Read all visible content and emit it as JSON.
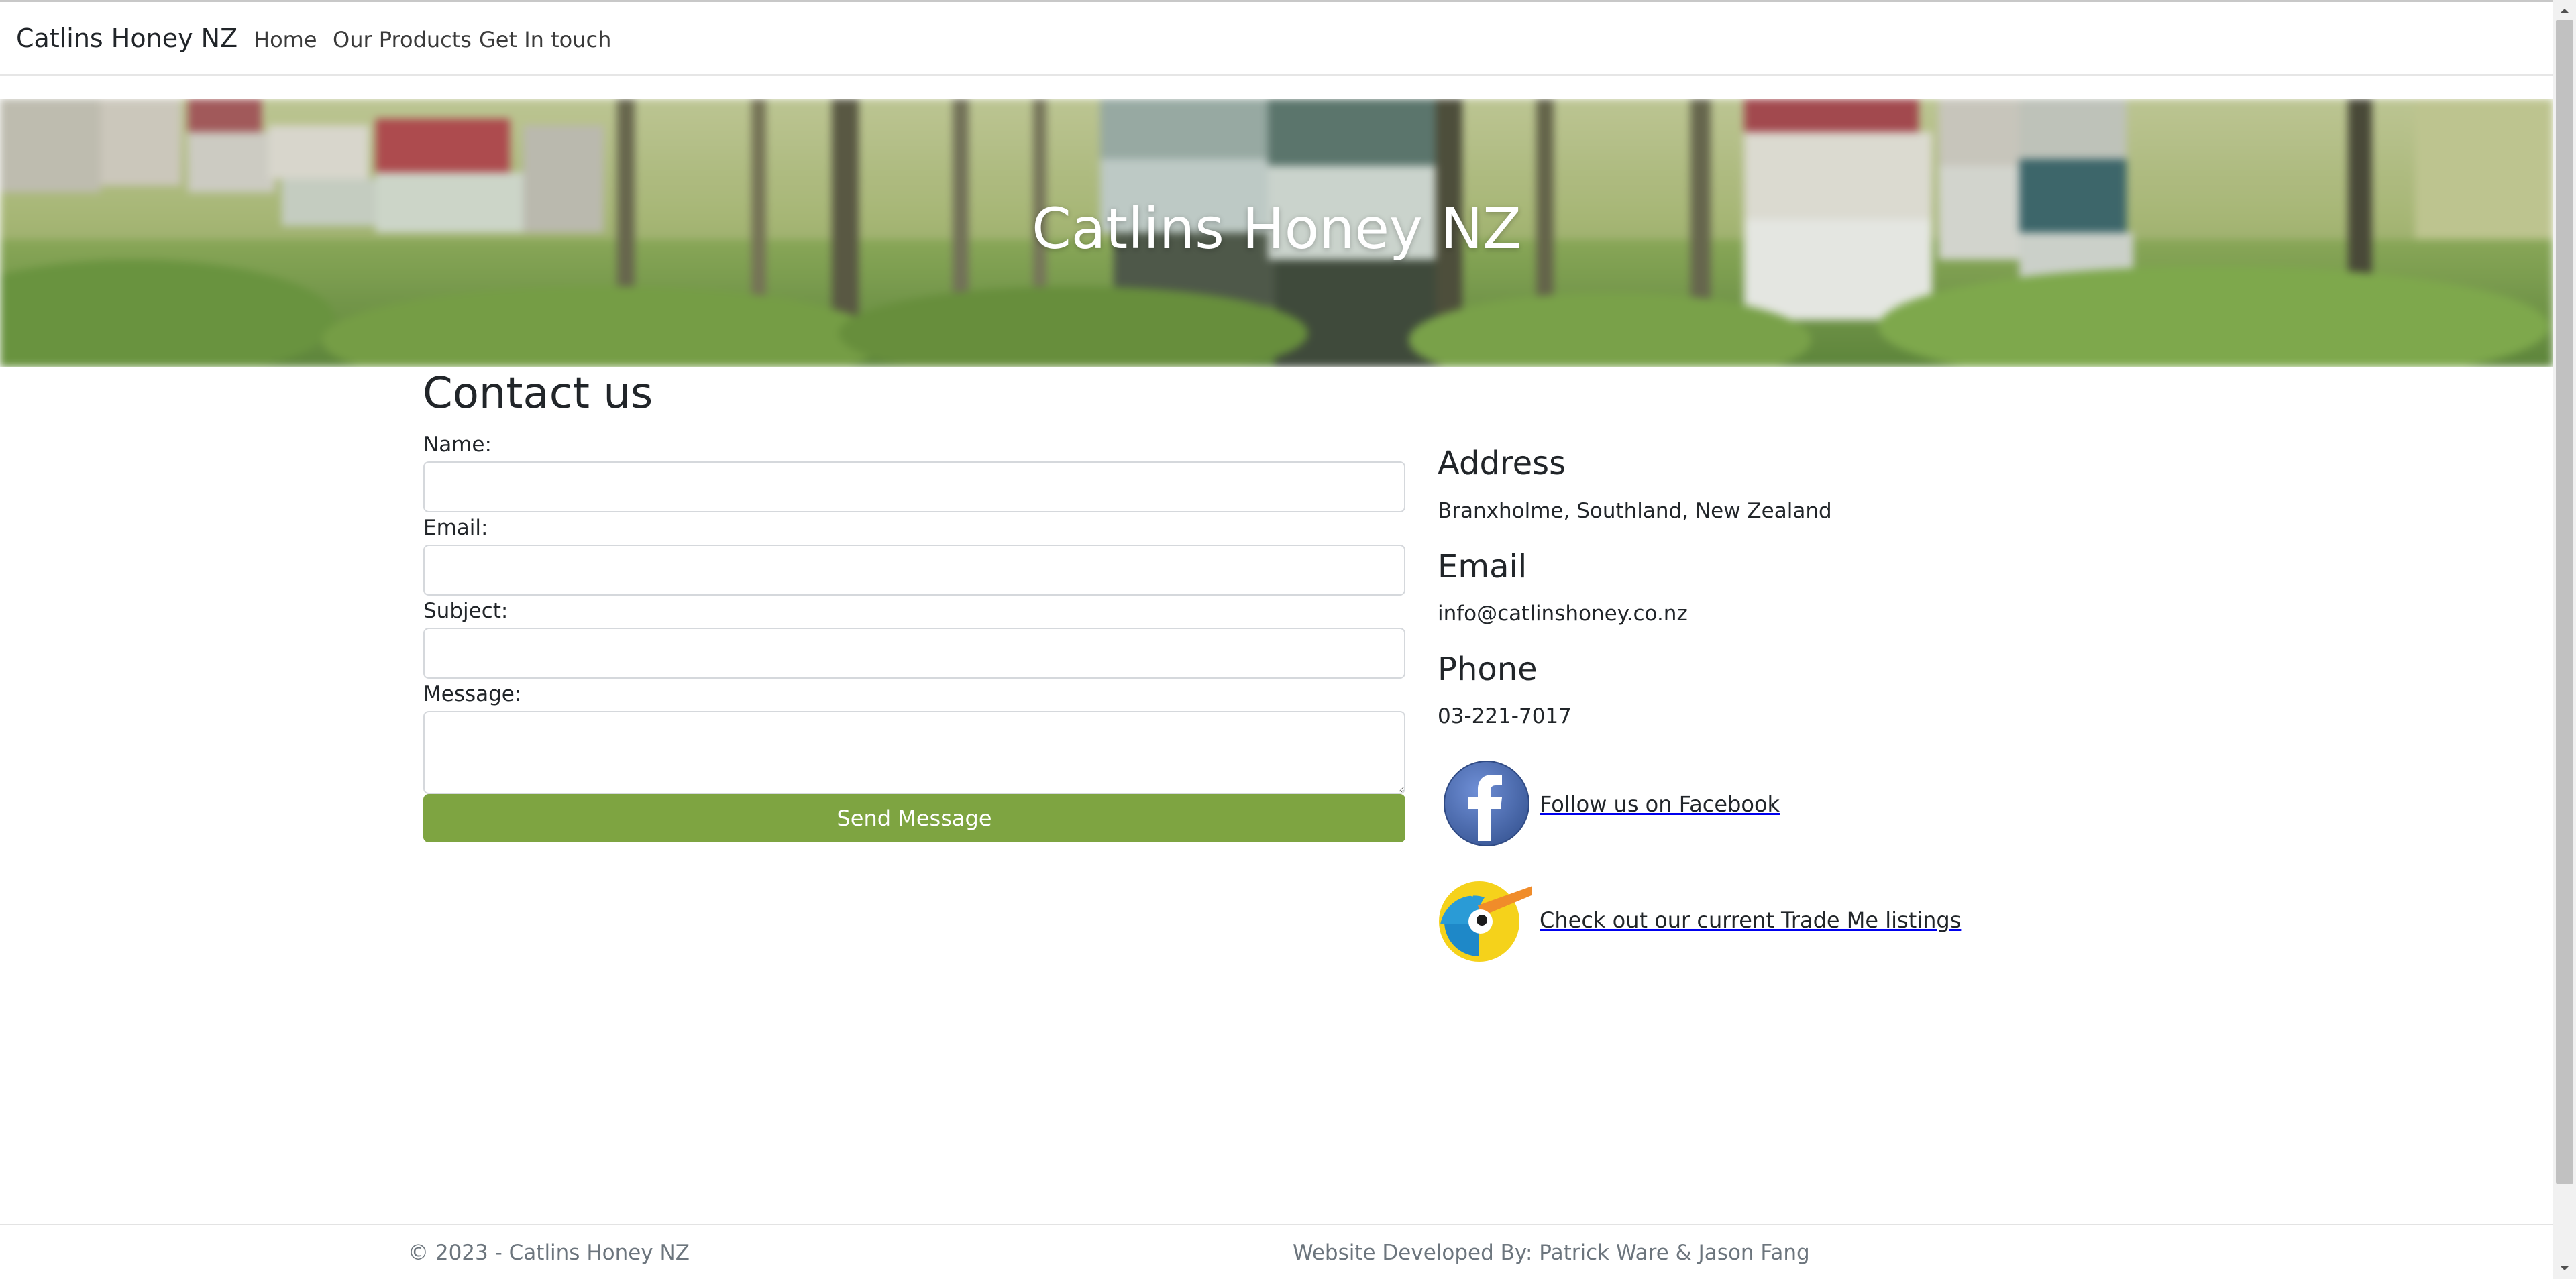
{
  "navbar": {
    "brand": "Catlins Honey NZ",
    "links": [
      "Home",
      "Our Products",
      "Get In touch"
    ]
  },
  "hero": {
    "title": "Catlins Honey NZ"
  },
  "contact": {
    "title": "Contact us",
    "fields": [
      {
        "label": "Name:",
        "value": ""
      },
      {
        "label": "Email:",
        "value": ""
      },
      {
        "label": "Subject:",
        "value": ""
      },
      {
        "label": "Message:",
        "value": ""
      }
    ],
    "submit_label": "Send Message"
  },
  "info": {
    "address_heading": "Address",
    "address": "Branxholme, Southland, New Zealand",
    "email_heading": "Email",
    "email": "info@catlinshoney.co.nz",
    "phone_heading": "Phone",
    "phone": "03-221-7017",
    "facebook_text": "Follow us on Facebook",
    "trademe_text": "Check out our current Trade Me listings"
  },
  "footer": {
    "left": "© 2023 - Catlins Honey NZ",
    "right": "Website Developed By: Patrick Ware & Jason Fang"
  },
  "colors": {
    "accent_green": "#7ea441",
    "facebook_blue": "#3b5998",
    "kiwi_yellow": "#f5d21b"
  },
  "icons": [
    "facebook-icon",
    "trademe-kiwi-icon"
  ]
}
